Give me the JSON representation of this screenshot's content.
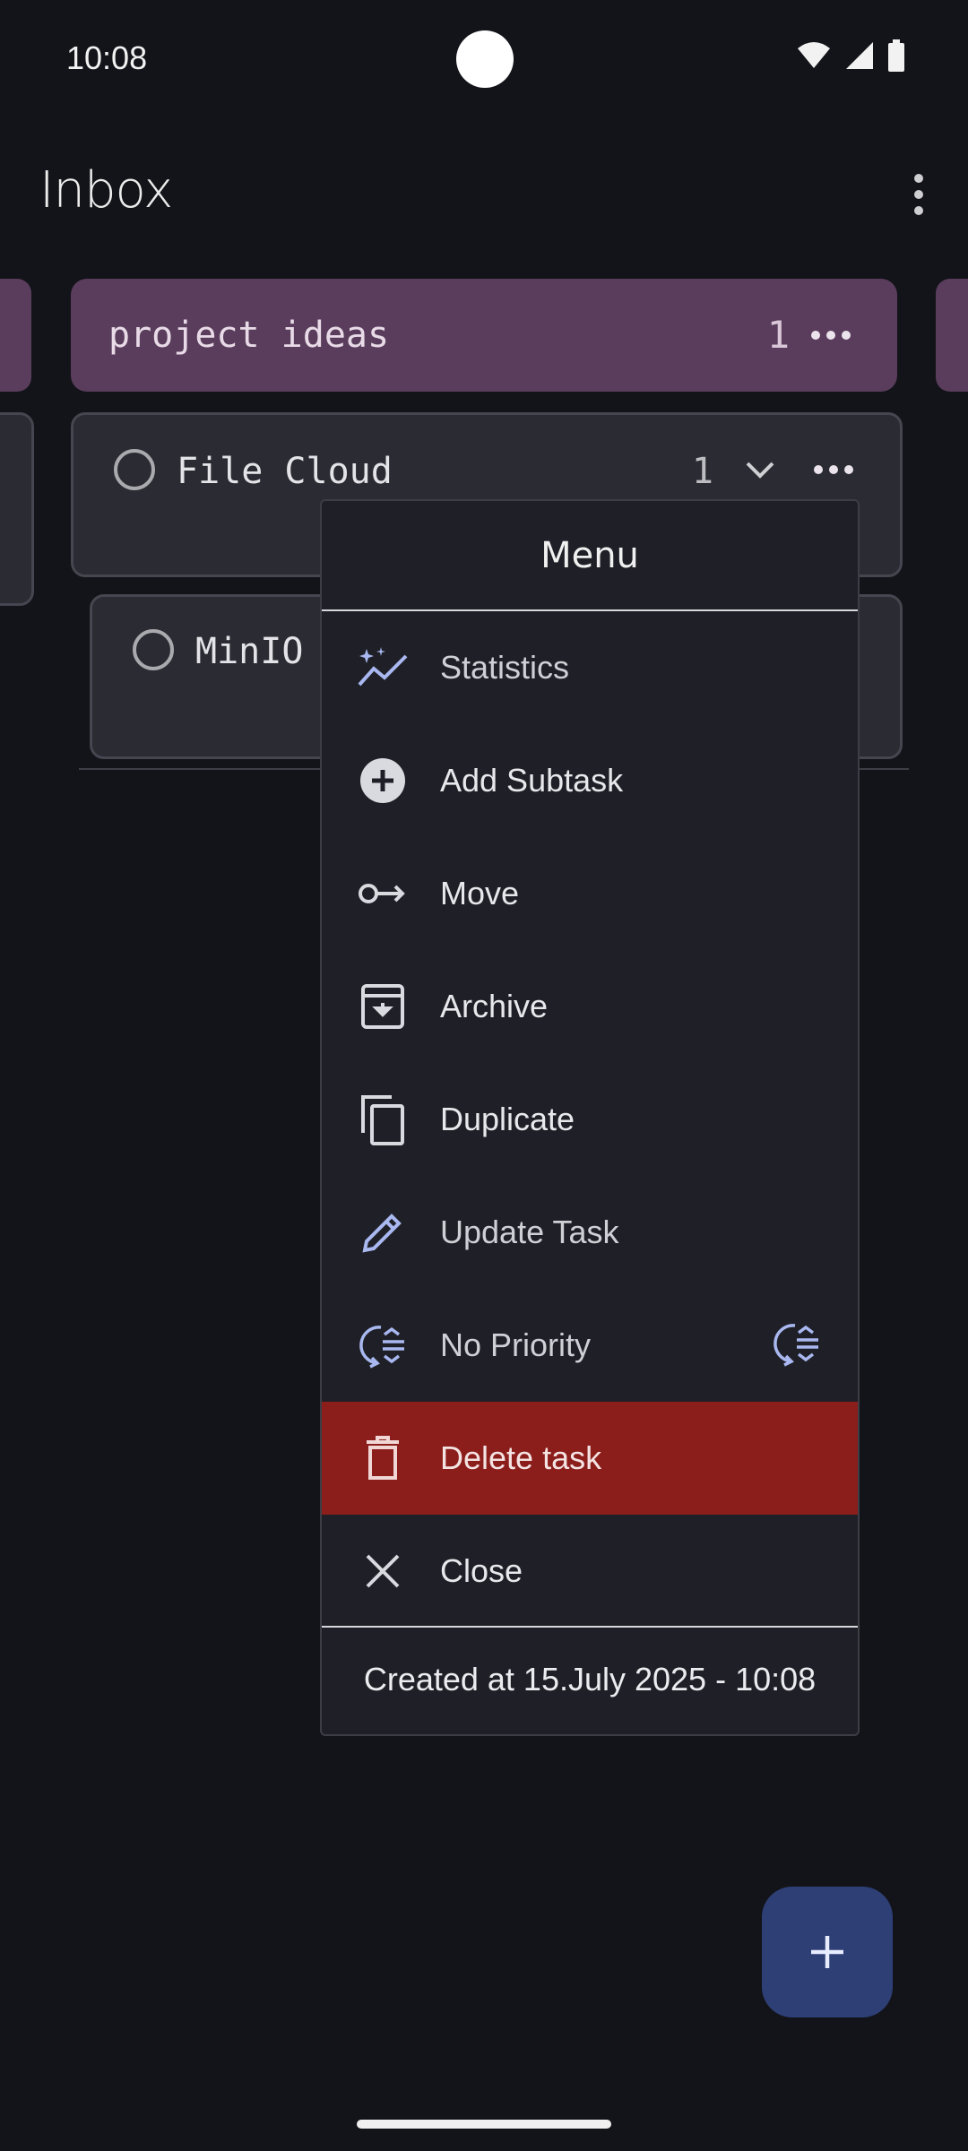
{
  "status_bar": {
    "time": "10:08"
  },
  "app_bar": {
    "title": "Inbox"
  },
  "board": {
    "column_title": "project ideas",
    "column_count": "1",
    "tasks": [
      {
        "label": "File Cloud",
        "count": "1"
      },
      {
        "label": "MinIO"
      }
    ]
  },
  "menu": {
    "title": "Menu",
    "items": [
      {
        "label": "Statistics",
        "icon": "statistics-icon"
      },
      {
        "label": "Add Subtask",
        "icon": "add-circle-icon"
      },
      {
        "label": "Move",
        "icon": "move-icon"
      },
      {
        "label": "Archive",
        "icon": "archive-icon"
      },
      {
        "label": "Duplicate",
        "icon": "duplicate-icon"
      },
      {
        "label": "Update Task",
        "icon": "pencil-icon"
      },
      {
        "label": "No Priority",
        "icon": "priority-icon"
      },
      {
        "label": "Delete task",
        "icon": "trash-icon"
      },
      {
        "label": "Close",
        "icon": "close-icon"
      }
    ],
    "footer": "Created at 15.July 2025 -  10:08"
  },
  "colors": {
    "background": "#131419",
    "column_header": "#5a3d5c",
    "delete_bg": "#8b1d1b",
    "fab": "#2e3f75",
    "accent_icon": "#a9b8f0"
  }
}
